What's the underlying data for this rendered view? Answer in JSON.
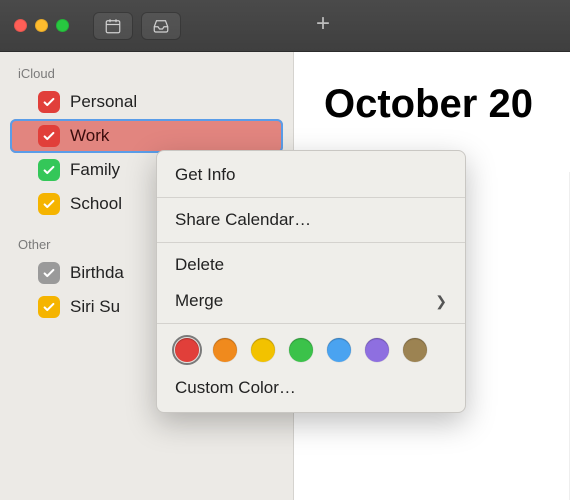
{
  "toolbar": {
    "calendar_view_button": "calendar",
    "inbox_button": "inbox",
    "add_button": "+"
  },
  "main": {
    "title": "October 20"
  },
  "sidebar": {
    "groups": [
      {
        "header": "iCloud",
        "items": [
          {
            "label": "Personal",
            "color": "#e13f3a",
            "checked": true,
            "selected": false
          },
          {
            "label": "Work",
            "color": "#e13f3a",
            "checked": true,
            "selected": true
          },
          {
            "label": "Family",
            "color": "#34c759",
            "checked": true,
            "selected": false
          },
          {
            "label": "School",
            "color": "#f5b400",
            "checked": true,
            "selected": false
          }
        ]
      },
      {
        "header": "Other",
        "items": [
          {
            "label": "Birthda",
            "color": "#9a9a9a",
            "checked": true,
            "selected": false
          },
          {
            "label": "Siri Su",
            "color": "#f5b400",
            "checked": true,
            "selected": false
          }
        ]
      }
    ]
  },
  "context_menu": {
    "get_info": "Get Info",
    "share": "Share Calendar…",
    "delete": "Delete",
    "merge": "Merge",
    "custom_color": "Custom Color…",
    "colors": [
      {
        "hex": "#e13f3a",
        "selected": true
      },
      {
        "hex": "#f08a1d",
        "selected": false
      },
      {
        "hex": "#f2c200",
        "selected": false
      },
      {
        "hex": "#3bc24a",
        "selected": false
      },
      {
        "hex": "#4aa3f0",
        "selected": false
      },
      {
        "hex": "#8e6fe0",
        "selected": false
      },
      {
        "hex": "#9c8352",
        "selected": false
      }
    ]
  }
}
